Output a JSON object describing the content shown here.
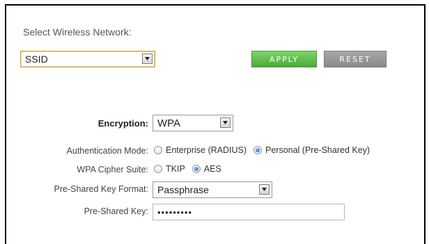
{
  "wireless": {
    "heading": "Select Wireless Network:",
    "ssid_value": "SSID",
    "apply_label": "APPLY",
    "reset_label": "RESET"
  },
  "security": {
    "encryption_label": "Encryption:",
    "encryption_value": "WPA",
    "auth_mode_label": "Authentication Mode:",
    "auth_options": [
      {
        "label": "Enterprise (RADIUS)",
        "selected": false
      },
      {
        "label": "Personal (Pre-Shared Key)",
        "selected": true
      }
    ],
    "cipher_label": "WPA Cipher Suite:",
    "cipher_options": [
      {
        "label": "TKIP",
        "selected": false
      },
      {
        "label": "AES",
        "selected": true
      }
    ],
    "psk_format_label": "Pre-Shared Key Format:",
    "psk_format_value": "Passphrase",
    "psk_label": "Pre-Shared Key:",
    "psk_value": "•••••••••"
  },
  "colors": {
    "apply_button": "#5bbd47",
    "reset_button": "#999999",
    "radio_selected": "#1d5fd4"
  },
  "icons": {
    "dropdown": "chevron-down-icon"
  }
}
